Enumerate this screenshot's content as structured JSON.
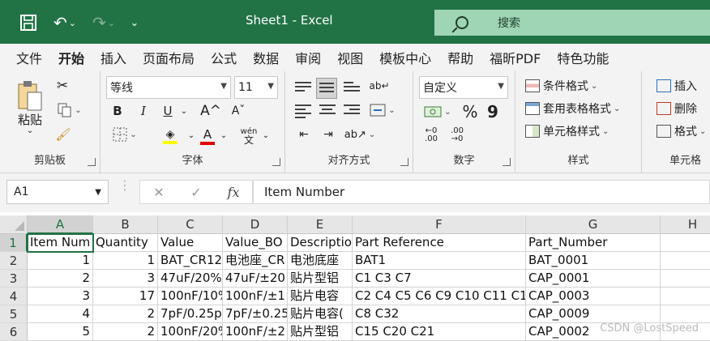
{
  "title": {
    "text": "Sheet1  -  Excel",
    "search": "搜索"
  },
  "menu": [
    "文件",
    "开始",
    "插入",
    "页面布局",
    "公式",
    "数据",
    "审阅",
    "视图",
    "模板中心",
    "帮助",
    "福昕PDF",
    "特色功能"
  ],
  "ribbon": {
    "clipboard": {
      "label": "剪贴板",
      "paste": "粘贴"
    },
    "font": {
      "label": "字体",
      "name": "等线",
      "size": "11",
      "bold": "B",
      "italic": "I",
      "underline": "U",
      "grow": "A^",
      "shrink": "Aˇ"
    },
    "align": {
      "label": "对齐方式"
    },
    "number": {
      "label": "数字",
      "format": "自定义",
      "percent": "%",
      "comma": "9"
    },
    "styles": {
      "label": "样式",
      "cond": "条件格式",
      "table": "套用表格格式",
      "cell": "单元格样式"
    },
    "cells": {
      "label": "单元格",
      "insert": "插入",
      "delete": "删除",
      "format": "格式"
    }
  },
  "formula_bar": {
    "name_box": "A1",
    "fx": "fx",
    "content": "Item Number"
  },
  "columns": [
    "A",
    "B",
    "C",
    "D",
    "E",
    "F",
    "G",
    "H"
  ],
  "rows": [
    {
      "n": "1",
      "cells": [
        "Item Num",
        "Quantity",
        "Value",
        "Value_BO",
        "Descriptio",
        "Part Reference",
        "Part_Number",
        ""
      ]
    },
    {
      "n": "2",
      "cells": [
        "1",
        "1",
        "BAT_CR12",
        "电池座_CR",
        "电池底座",
        "BAT1",
        "BAT_0001",
        ""
      ]
    },
    {
      "n": "3",
      "cells": [
        "2",
        "3",
        "47uF/20%/",
        "47uF/±20",
        "贴片型铝",
        "C1 C3 C7",
        "CAP_0001",
        ""
      ]
    },
    {
      "n": "4",
      "cells": [
        "3",
        "17",
        "100nF/10%",
        "100nF/±1",
        "贴片电容",
        "C2 C4 C5 C6 C9 C10 C11 C1",
        "CAP_0003",
        ""
      ]
    },
    {
      "n": "5",
      "cells": [
        "4",
        "2",
        "7pF/0.25p",
        "7pF/±0.25",
        "贴片电容(",
        "C8 C32",
        "CAP_0009",
        ""
      ]
    },
    {
      "n": "6",
      "cells": [
        "5",
        "2",
        "100nF/20%",
        "100nF/±2",
        "贴片型铝",
        "C15 C20 C21",
        "CAP_0002",
        ""
      ]
    }
  ],
  "watermark": "CSDN @LostSpeed",
  "colors": {
    "accent": "#217346",
    "search_bg": "#9fd5b4"
  }
}
